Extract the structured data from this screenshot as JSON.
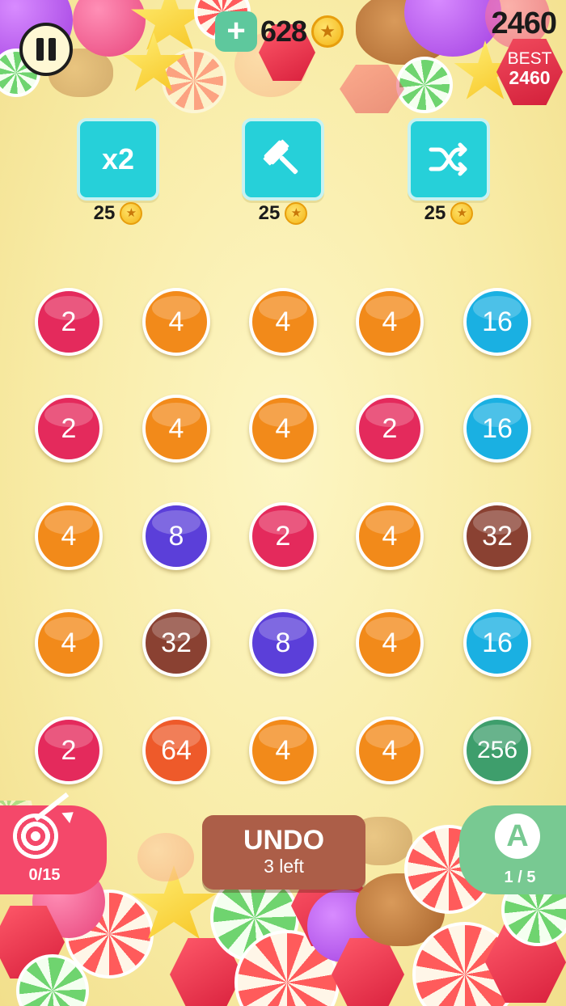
{
  "hud": {
    "add_coins_label": "+",
    "coins": "628",
    "score": "2460",
    "best_label": "BEST",
    "best_value": "2460"
  },
  "powerups": [
    {
      "label": "x2",
      "icon": "double-icon",
      "cost": "25"
    },
    {
      "label": "",
      "icon": "hammer-icon",
      "cost": "25"
    },
    {
      "label": "",
      "icon": "shuffle-icon",
      "cost": "25"
    }
  ],
  "board": {
    "rows": [
      [
        "2",
        "4",
        "4",
        "4",
        "16"
      ],
      [
        "2",
        "4",
        "4",
        "2",
        "16"
      ],
      [
        "4",
        "8",
        "2",
        "4",
        "32"
      ],
      [
        "4",
        "32",
        "8",
        "4",
        "16"
      ],
      [
        "2",
        "64",
        "4",
        "4",
        "256"
      ]
    ],
    "colors": {
      "2": "#e42a5c",
      "4": "#f28a1a",
      "8": "#5b3fd9",
      "16": "#1ab0e2",
      "32": "#8a4132",
      "64": "#ee5a2a",
      "256": "#3e9e6c"
    }
  },
  "bottom": {
    "target_count": "0/15",
    "undo_label": "UNDO",
    "undo_sub": "3 left",
    "auto_letter": "A",
    "auto_count": "1 / 5"
  }
}
